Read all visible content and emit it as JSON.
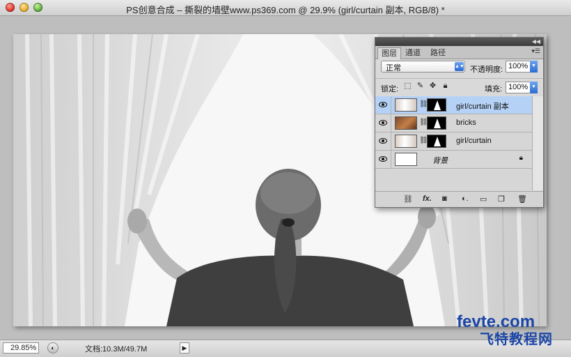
{
  "window": {
    "title": "PS创意合成 – 撕裂的墙壁www.ps369.com @ 29.9% (girl/curtain 副本, RGB/8) *"
  },
  "statusbar": {
    "zoom": "29.85%",
    "doc_info": "文档:10.3M/49.7M"
  },
  "layers_panel": {
    "tabs": [
      "图层",
      "通道",
      "路径"
    ],
    "blend_mode": "正常",
    "opacity_label": "不透明度:",
    "opacity": "100%",
    "lock_label": "锁定:",
    "fill_label": "填充:",
    "fill": "100%",
    "layers": [
      {
        "name": "girl/curtain 副本",
        "selected": true,
        "visible": true
      },
      {
        "name": "bricks",
        "selected": false,
        "visible": true
      },
      {
        "name": "girl/curtain",
        "selected": false,
        "visible": true
      },
      {
        "name": "背景",
        "selected": false,
        "visible": true,
        "locked": true
      }
    ],
    "footer_icons": [
      "link-icon",
      "fx-icon",
      "mask-icon",
      "adjustment-icon",
      "group-icon",
      "new-layer-icon",
      "trash-icon"
    ]
  },
  "watermark": {
    "top": "fevte.com",
    "bottom": "飞特教程网"
  },
  "colors": {
    "selected_layer": "#b5d2f6",
    "accent_blue": "#2c6bd1",
    "watermark_blue": "#1b45a6"
  }
}
